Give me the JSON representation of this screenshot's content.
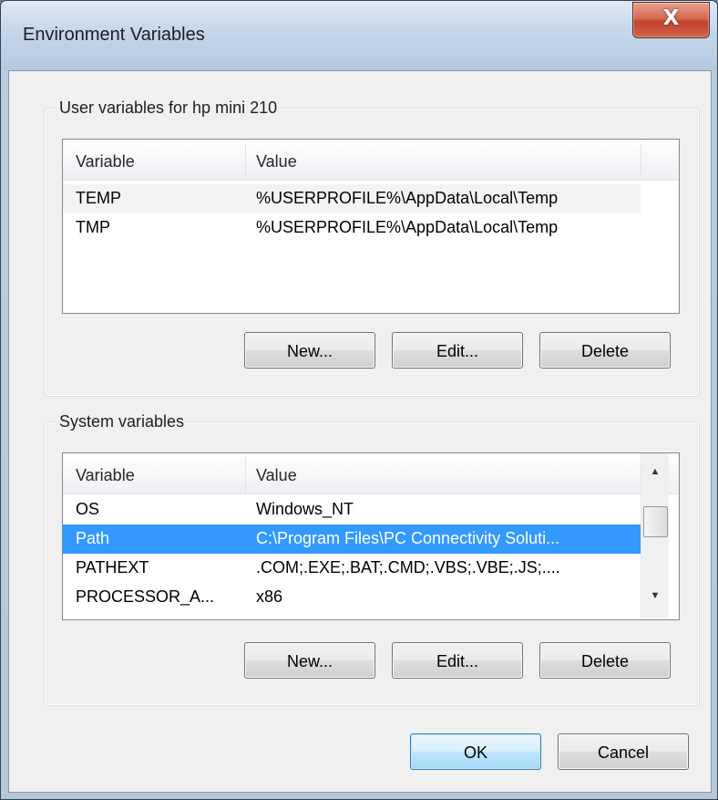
{
  "window": {
    "title": "Environment Variables",
    "close_glyph": "X"
  },
  "user_group": {
    "legend": "User variables for hp mini 210",
    "columns": [
      "Variable",
      "Value"
    ],
    "rows": [
      {
        "variable": "TEMP",
        "value": "%USERPROFILE%\\AppData\\Local\\Temp"
      },
      {
        "variable": "TMP",
        "value": "%USERPROFILE%\\AppData\\Local\\Temp"
      }
    ],
    "buttons": {
      "new": "New...",
      "edit": "Edit...",
      "delete": "Delete"
    }
  },
  "system_group": {
    "legend": "System variables",
    "columns": [
      "Variable",
      "Value"
    ],
    "rows": [
      {
        "variable": "OS",
        "value": "Windows_NT"
      },
      {
        "variable": "Path",
        "value": "C:\\Program Files\\PC Connectivity Soluti..."
      },
      {
        "variable": "PATHEXT",
        "value": ".COM;.EXE;.BAT;.CMD;.VBS;.VBE;.JS;...."
      },
      {
        "variable": "PROCESSOR_A...",
        "value": "x86"
      }
    ],
    "selected_row": "Path",
    "buttons": {
      "new": "New...",
      "edit": "Edit...",
      "delete": "Delete"
    }
  },
  "footer": {
    "ok": "OK",
    "cancel": "Cancel"
  },
  "colors": {
    "selection": "#3399ff",
    "close_button": "#c2412a",
    "default_button_border": "#3c7fb1"
  }
}
